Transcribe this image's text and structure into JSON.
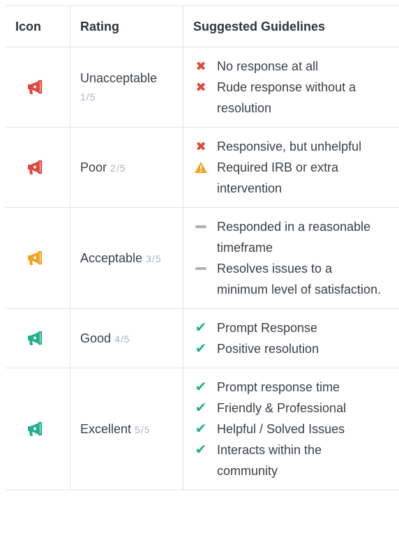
{
  "header": {
    "icon": "Icon",
    "rating": "Rating",
    "guidelines": "Suggested Guidelines"
  },
  "colors": {
    "red": "#e0463c",
    "orange": "#f4a224",
    "green": "#21b08a",
    "grey": "#aab2bb"
  },
  "rows": [
    {
      "icon": "megaphone-icon",
      "icon_color": "#e0463c",
      "label": "Unacceptable",
      "score": "1/5",
      "guidelines": [
        {
          "mark": "x-icon",
          "text": "No response at all"
        },
        {
          "mark": "x-icon",
          "text": "Rude response without a resolution"
        }
      ]
    },
    {
      "icon": "megaphone-icon",
      "icon_color": "#e0463c",
      "label": "Poor",
      "score": "2/5",
      "guidelines": [
        {
          "mark": "x-icon",
          "text": "Responsive, but unhelpful"
        },
        {
          "mark": "warning-icon",
          "text": "Required IRB or extra intervention"
        }
      ]
    },
    {
      "icon": "megaphone-icon",
      "icon_color": "#f4a224",
      "label": "Acceptable",
      "score": "3/5",
      "guidelines": [
        {
          "mark": "dash-icon",
          "text": "Responded in a reasonable timeframe"
        },
        {
          "mark": "dash-icon",
          "text": "Resolves issues to a minimum level of satisfaction."
        }
      ]
    },
    {
      "icon": "megaphone-icon",
      "icon_color": "#21b08a",
      "label": "Good",
      "score": "4/5",
      "guidelines": [
        {
          "mark": "check-icon",
          "text": "Prompt Response"
        },
        {
          "mark": "check-icon",
          "text": "Positive resolution"
        }
      ]
    },
    {
      "icon": "megaphone-icon",
      "icon_color": "#21b08a",
      "label": "Excellent",
      "score": "5/5",
      "guidelines": [
        {
          "mark": "check-icon",
          "text": "Prompt response time"
        },
        {
          "mark": "check-icon",
          "text": "Friendly & Professional"
        },
        {
          "mark": "check-icon",
          "text": "Helpful / Solved Issues"
        },
        {
          "mark": "check-icon",
          "text": "Interacts within the community"
        }
      ]
    }
  ]
}
